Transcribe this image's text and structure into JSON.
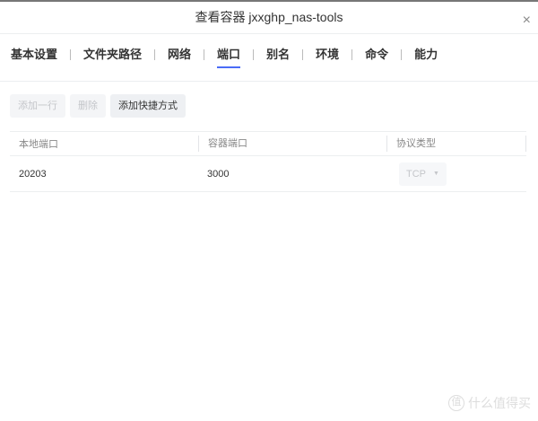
{
  "dialog": {
    "title": "查看容器 jxxghp_nas-tools",
    "close": "×"
  },
  "tabs": [
    {
      "label": "基本设置"
    },
    {
      "label": "文件夹路径"
    },
    {
      "label": "网络"
    },
    {
      "label": "端口",
      "active": true
    },
    {
      "label": "别名"
    },
    {
      "label": "环境"
    },
    {
      "label": "命令"
    },
    {
      "label": "能力"
    }
  ],
  "toolbar": {
    "add_row": "添加一行",
    "delete": "删除",
    "add_shortcut": "添加快捷方式"
  },
  "table": {
    "headers": [
      "本地端口",
      "容器端口",
      "协议类型"
    ],
    "rows": [
      {
        "local": "20203",
        "container": "3000",
        "protocol": "TCP"
      }
    ]
  },
  "accent": "#4a6cf7",
  "watermark": {
    "icon": "值",
    "text": "什么值得买"
  }
}
